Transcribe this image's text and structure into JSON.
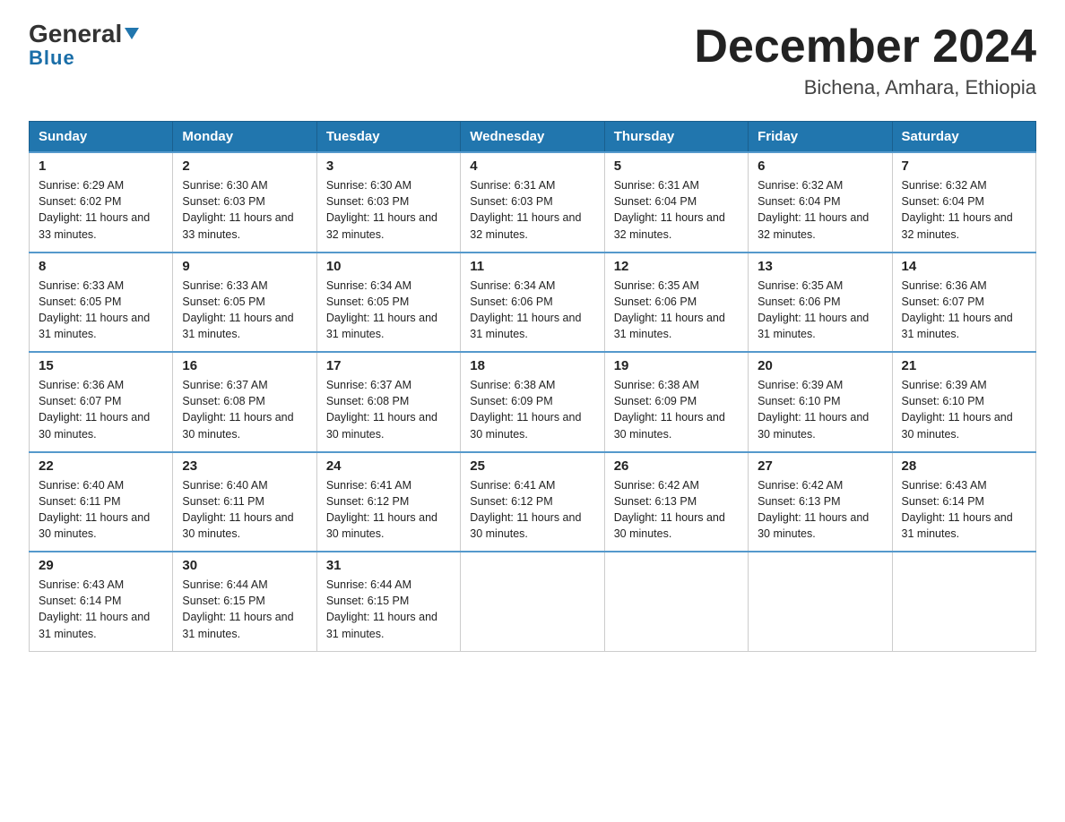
{
  "logo": {
    "general": "General",
    "triangle": "",
    "blue": "Blue"
  },
  "header": {
    "month": "December 2024",
    "location": "Bichena, Amhara, Ethiopia"
  },
  "days": [
    "Sunday",
    "Monday",
    "Tuesday",
    "Wednesday",
    "Thursday",
    "Friday",
    "Saturday"
  ],
  "weeks": [
    [
      {
        "day": "1",
        "sunrise": "6:29 AM",
        "sunset": "6:02 PM",
        "daylight": "11 hours and 33 minutes."
      },
      {
        "day": "2",
        "sunrise": "6:30 AM",
        "sunset": "6:03 PM",
        "daylight": "11 hours and 33 minutes."
      },
      {
        "day": "3",
        "sunrise": "6:30 AM",
        "sunset": "6:03 PM",
        "daylight": "11 hours and 32 minutes."
      },
      {
        "day": "4",
        "sunrise": "6:31 AM",
        "sunset": "6:03 PM",
        "daylight": "11 hours and 32 minutes."
      },
      {
        "day": "5",
        "sunrise": "6:31 AM",
        "sunset": "6:04 PM",
        "daylight": "11 hours and 32 minutes."
      },
      {
        "day": "6",
        "sunrise": "6:32 AM",
        "sunset": "6:04 PM",
        "daylight": "11 hours and 32 minutes."
      },
      {
        "day": "7",
        "sunrise": "6:32 AM",
        "sunset": "6:04 PM",
        "daylight": "11 hours and 32 minutes."
      }
    ],
    [
      {
        "day": "8",
        "sunrise": "6:33 AM",
        "sunset": "6:05 PM",
        "daylight": "11 hours and 31 minutes."
      },
      {
        "day": "9",
        "sunrise": "6:33 AM",
        "sunset": "6:05 PM",
        "daylight": "11 hours and 31 minutes."
      },
      {
        "day": "10",
        "sunrise": "6:34 AM",
        "sunset": "6:05 PM",
        "daylight": "11 hours and 31 minutes."
      },
      {
        "day": "11",
        "sunrise": "6:34 AM",
        "sunset": "6:06 PM",
        "daylight": "11 hours and 31 minutes."
      },
      {
        "day": "12",
        "sunrise": "6:35 AM",
        "sunset": "6:06 PM",
        "daylight": "11 hours and 31 minutes."
      },
      {
        "day": "13",
        "sunrise": "6:35 AM",
        "sunset": "6:06 PM",
        "daylight": "11 hours and 31 minutes."
      },
      {
        "day": "14",
        "sunrise": "6:36 AM",
        "sunset": "6:07 PM",
        "daylight": "11 hours and 31 minutes."
      }
    ],
    [
      {
        "day": "15",
        "sunrise": "6:36 AM",
        "sunset": "6:07 PM",
        "daylight": "11 hours and 30 minutes."
      },
      {
        "day": "16",
        "sunrise": "6:37 AM",
        "sunset": "6:08 PM",
        "daylight": "11 hours and 30 minutes."
      },
      {
        "day": "17",
        "sunrise": "6:37 AM",
        "sunset": "6:08 PM",
        "daylight": "11 hours and 30 minutes."
      },
      {
        "day": "18",
        "sunrise": "6:38 AM",
        "sunset": "6:09 PM",
        "daylight": "11 hours and 30 minutes."
      },
      {
        "day": "19",
        "sunrise": "6:38 AM",
        "sunset": "6:09 PM",
        "daylight": "11 hours and 30 minutes."
      },
      {
        "day": "20",
        "sunrise": "6:39 AM",
        "sunset": "6:10 PM",
        "daylight": "11 hours and 30 minutes."
      },
      {
        "day": "21",
        "sunrise": "6:39 AM",
        "sunset": "6:10 PM",
        "daylight": "11 hours and 30 minutes."
      }
    ],
    [
      {
        "day": "22",
        "sunrise": "6:40 AM",
        "sunset": "6:11 PM",
        "daylight": "11 hours and 30 minutes."
      },
      {
        "day": "23",
        "sunrise": "6:40 AM",
        "sunset": "6:11 PM",
        "daylight": "11 hours and 30 minutes."
      },
      {
        "day": "24",
        "sunrise": "6:41 AM",
        "sunset": "6:12 PM",
        "daylight": "11 hours and 30 minutes."
      },
      {
        "day": "25",
        "sunrise": "6:41 AM",
        "sunset": "6:12 PM",
        "daylight": "11 hours and 30 minutes."
      },
      {
        "day": "26",
        "sunrise": "6:42 AM",
        "sunset": "6:13 PM",
        "daylight": "11 hours and 30 minutes."
      },
      {
        "day": "27",
        "sunrise": "6:42 AM",
        "sunset": "6:13 PM",
        "daylight": "11 hours and 30 minutes."
      },
      {
        "day": "28",
        "sunrise": "6:43 AM",
        "sunset": "6:14 PM",
        "daylight": "11 hours and 31 minutes."
      }
    ],
    [
      {
        "day": "29",
        "sunrise": "6:43 AM",
        "sunset": "6:14 PM",
        "daylight": "11 hours and 31 minutes."
      },
      {
        "day": "30",
        "sunrise": "6:44 AM",
        "sunset": "6:15 PM",
        "daylight": "11 hours and 31 minutes."
      },
      {
        "day": "31",
        "sunrise": "6:44 AM",
        "sunset": "6:15 PM",
        "daylight": "11 hours and 31 minutes."
      },
      null,
      null,
      null,
      null
    ]
  ]
}
